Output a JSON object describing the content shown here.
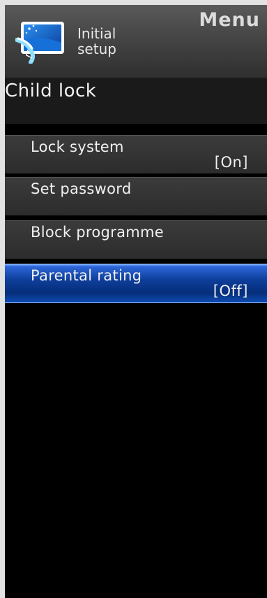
{
  "header": {
    "menu_label": "Menu",
    "section_line1": "Initial",
    "section_line2": "setup",
    "section_icon": "initial-setup-icon"
  },
  "submenu": {
    "title": "Child lock"
  },
  "items": [
    {
      "label": "Lock system",
      "value": "[On]",
      "selected": false
    },
    {
      "label": "Set password",
      "value": "",
      "selected": false
    },
    {
      "label": "Block programme",
      "value": "",
      "selected": false
    },
    {
      "label": "Parental rating",
      "value": "[Off]",
      "selected": true
    }
  ],
  "colors": {
    "highlight": "#0e3f9c",
    "background": "#000000",
    "item_bg": "#333333",
    "outer_frame": "#e2e2e2"
  }
}
